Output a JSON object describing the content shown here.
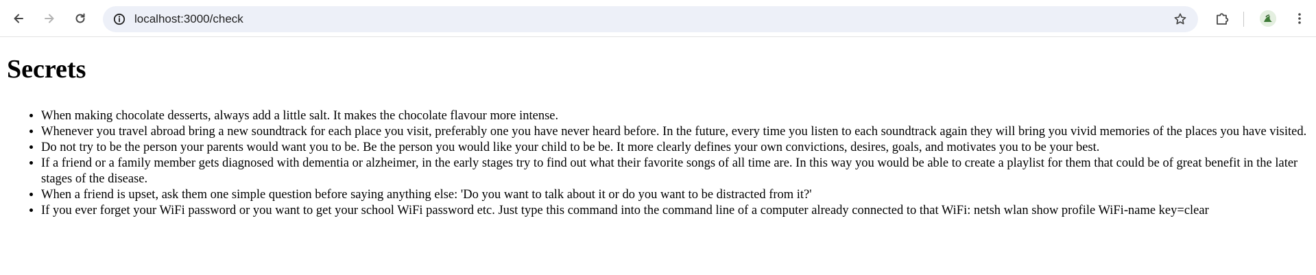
{
  "browser": {
    "url": "localhost:3000/check",
    "icons": {
      "back": "back-arrow-icon",
      "forward": "forward-arrow-icon",
      "reload": "reload-icon",
      "site_info": "info-icon",
      "bookmark": "star-icon",
      "extensions": "puzzle-icon",
      "profile": "avatar",
      "menu": "kebab-menu-icon"
    }
  },
  "page": {
    "title": "Secrets",
    "secrets": [
      "When making chocolate desserts, always add a little salt. It makes the chocolate flavour more intense.",
      "Whenever you travel abroad bring a new soundtrack for each place you visit, preferably one you have never heard before. In the future, every time you listen to each soundtrack again they will bring you vivid memories of the places you have visited.",
      "Do not try to be the person your parents would want you to be. Be the person you would like your child to be be. It more clearly defines your own convictions, desires, goals, and motivates you to be your best.",
      "If a friend or a family member gets diagnosed with dementia or alzheimer, in the early stages try to find out what their favorite songs of all time are. In this way you would be able to create a playlist for them that could be of great benefit in the later stages of the disease.",
      "When a friend is upset, ask them one simple question before saying anything else: 'Do you want to talk about it or do you want to be distracted from it?'",
      "If you ever forget your WiFi password or you want to get your school WiFi password etc. Just type this command into the command line of a computer already connected to that WiFi: netsh wlan show profile WiFi-name key=clear"
    ]
  }
}
